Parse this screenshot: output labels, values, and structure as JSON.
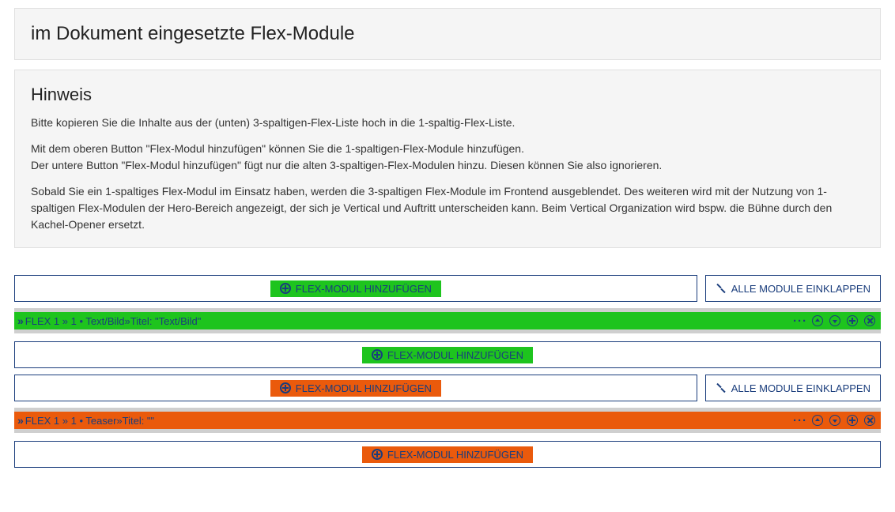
{
  "header": {
    "title": "im Dokument eingesetzte Flex-Module"
  },
  "notice": {
    "heading": "Hinweis",
    "p1": "Bitte kopieren Sie die Inhalte aus der (unten) 3-spaltigen-Flex-Liste hoch in die 1-spaltig-Flex-Liste.",
    "p2": "Mit dem oberen Button \"Flex-Modul hinzufügen\" können Sie die 1-spaltigen-Flex-Module hinzufügen.\nDer untere Button \"Flex-Modul hinzufügen\" fügt nur die alten 3-spaltigen-Flex-Modulen hinzu. Diesen können Sie also ignorieren.",
    "p3": "Sobald Sie ein 1-spaltiges Flex-Modul im Einsatz haben, werden die 3-spaltigen Flex-Module im Frontend ausgeblendet. Des weiteren wird mit der Nutzung von 1-spaltigen Flex-Modulen der Hero-Bereich angezeigt, der sich je Vertical und Auftritt unterscheiden kann. Beim Vertical Organization wird bspw. die Bühne durch den Kachel-Opener ersetzt."
  },
  "buttons": {
    "add_flex": "FLEX-MODUL HINZUFÜGEN",
    "collapse_all": "ALLE MODULE EINKLAPPEN"
  },
  "section_green": {
    "module_label": "FLEX 1 »  1 • Text/Bild»Titel: \"Text/Bild\""
  },
  "section_orange": {
    "module_label": "FLEX 1 »  1 • Teaser»Titel: \"\""
  },
  "actions": {
    "more": "···"
  }
}
